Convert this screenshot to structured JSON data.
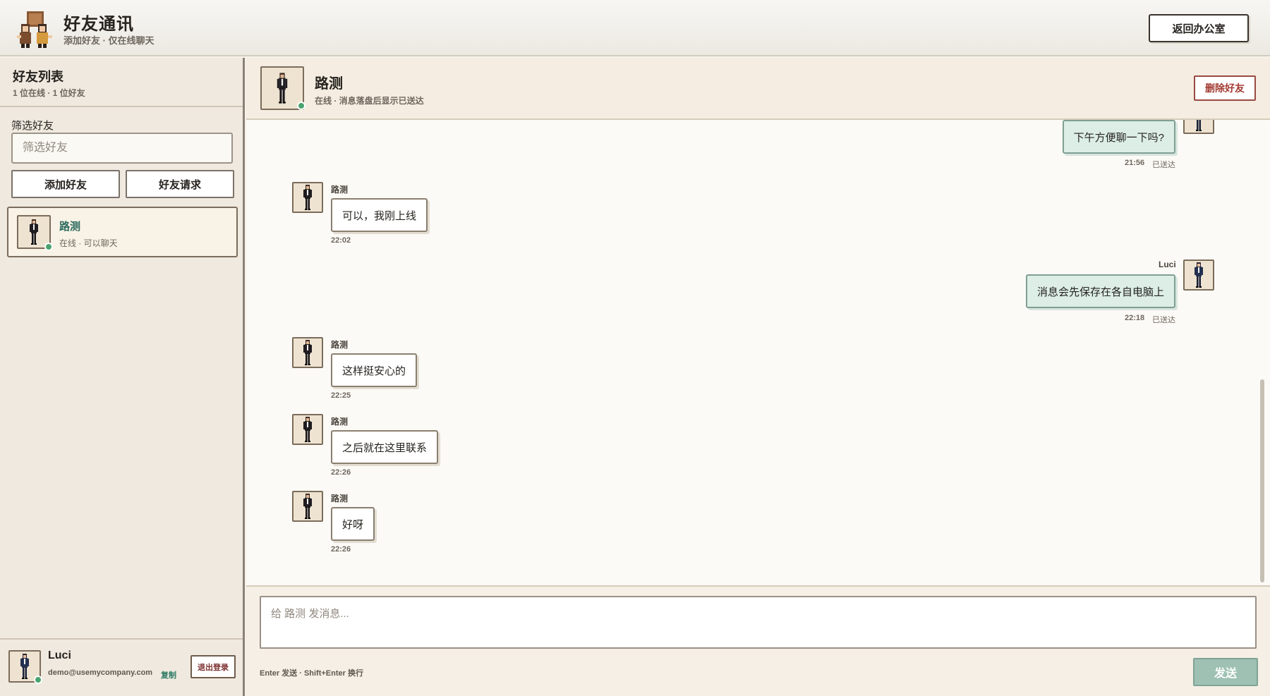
{
  "header": {
    "title": "好友通讯",
    "subtitle": "添加好友 · 仅在线聊天",
    "back_label": "返回办公室"
  },
  "sidebar": {
    "title": "好友列表",
    "count": "1 位在线 · 1 位好友",
    "filter_label": "筛选好友",
    "filter_placeholder": "筛选好友",
    "add_friend_label": "添加好友",
    "friend_requests_label": "好友请求",
    "friends": [
      {
        "name": "路测",
        "status": "在线 · 可以聊天"
      }
    ],
    "me": {
      "name": "Luci",
      "email": "demo@usemycompany.com",
      "copy_label": "复制",
      "logout_label": "退出登录"
    }
  },
  "chat": {
    "name": "路测",
    "status": "在线 · 消息落盘后显示已送达",
    "delete_label": "删除好友",
    "messages": [
      {
        "from": "me",
        "sender": "",
        "text": "下午方便聊一下吗?",
        "time": "21:56",
        "delivered": "已送达"
      },
      {
        "from": "friend",
        "sender": "路测",
        "text": "可以，我刚上线",
        "time": "22:02"
      },
      {
        "from": "me",
        "sender": "Luci",
        "text": "消息会先保存在各自电脑上",
        "time": "22:18",
        "delivered": "已送达"
      },
      {
        "from": "friend",
        "sender": "路测",
        "text": "这样挺安心的",
        "time": "22:25"
      },
      {
        "from": "friend",
        "sender": "路测",
        "text": "之后就在这里联系",
        "time": "22:26"
      },
      {
        "from": "friend",
        "sender": "路测",
        "text": "好呀",
        "time": "22:26"
      }
    ],
    "composer_placeholder": "给 路测 发消息...",
    "hint": "Enter 发送 · Shift+Enter 换行",
    "send_label": "发送"
  },
  "colors": {
    "accent_green": "#4aa36e",
    "friend_name": "#2d6b5e",
    "delete_red": "#a33b33",
    "send_button": "#9ec1b4"
  },
  "icons": {
    "logo": "office-characters-logo",
    "avatar": "pixel-person-avatar"
  }
}
